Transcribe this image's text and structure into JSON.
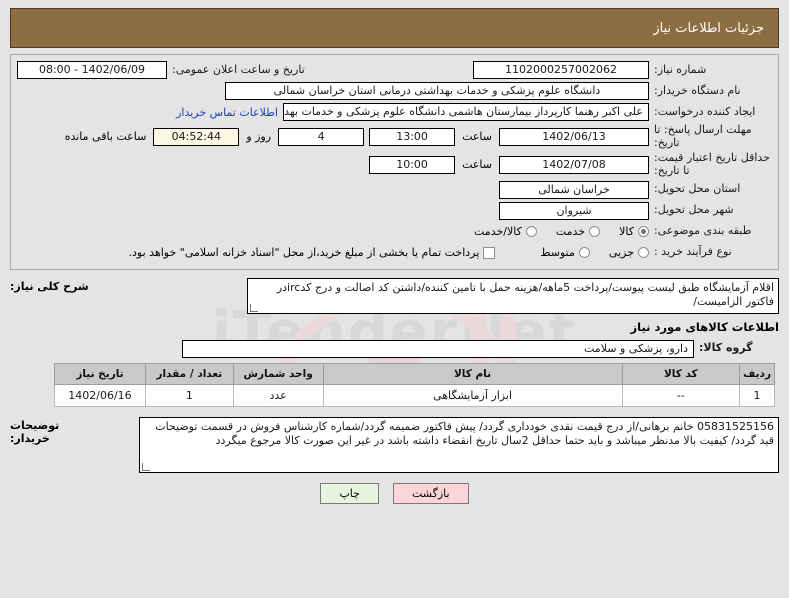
{
  "window": {
    "title": "جزئیات اطلاعات نیاز"
  },
  "colors": {
    "header_bg": "#8d6e42",
    "header_text": "#ffffff",
    "page_bg": "#e4e4e4",
    "field_bg": "#ffffff",
    "link": "#1c3fbf",
    "countdown_bg": "#fbf8e3",
    "table_header_bg": "#c9c9c9",
    "btn_back_bg": "#fbd5d8",
    "btn_print_bg": "#e6f5e0"
  },
  "form": {
    "need_number": {
      "label": "شماره نیاز:",
      "value": "1102000257002062"
    },
    "announce": {
      "label": "تاریخ و ساعت اعلان عمومی:",
      "value": "08:00 - 1402/06/09"
    },
    "buyer_org": {
      "label": "نام دستگاه خریدار:",
      "value": "دانشگاه علوم پزشکی و خدمات بهداشتی درمانی استان خراسان شمالی"
    },
    "creator": {
      "label": "ایجاد کننده درخواست:",
      "value": "علی اکبر رهنما کارپرداز بیمارستان هاشمی دانشگاه علوم پزشکی و خدمات بهد",
      "contact_link": "اطلاعات تماس خریدار"
    },
    "response_deadline": {
      "label": "مهلت ارسال پاسخ: تا تاریخ:",
      "date": "1402/06/13",
      "time_label": "ساعت",
      "time": "13:00",
      "days": "4",
      "days_label": "روز و",
      "clock": "04:52:44",
      "remaining_label": "ساعت باقی مانده"
    },
    "price_validity": {
      "label": "حداقل تاریخ اعتبار قیمت: تا تاریخ:",
      "date": "1402/07/08",
      "time_label": "ساعت",
      "time": "10:00"
    },
    "province": {
      "label": "استان محل تحویل:",
      "value": "خراسان شمالی"
    },
    "city": {
      "label": "شهر محل تحویل:",
      "value": "شیروان"
    },
    "category": {
      "label": "طبقه بندی موضوعی:",
      "options": [
        {
          "text": "کالا",
          "selected": true
        },
        {
          "text": "خدمت",
          "selected": false
        },
        {
          "text": "کالا/خدمت",
          "selected": false
        }
      ]
    },
    "process_type": {
      "label": "نوع فرآیند خرید :",
      "options": [
        {
          "text": "جزیی",
          "selected": false
        },
        {
          "text": "متوسط",
          "selected": false
        }
      ],
      "checkbox": {
        "checked": false,
        "text": "پرداخت تمام یا بخشی از مبلغ خرید،از محل \"اسناد خزانه اسلامی\" خواهد بود."
      }
    },
    "description": {
      "label": "شرح کلی نیاز:",
      "value": "اقلام آزمایشگاه طبق لیست پیوست/پرداخت 5ماهه/هزینه حمل با تامین کننده/داشتن کد اصالت و درج کدircدر فاکتور الزامیست/"
    }
  },
  "goods_section": {
    "heading": "اطلاعات کالاهای مورد نیاز",
    "group": {
      "label": "گروه کالا:",
      "value": "دارو، پزشکی و سلامت"
    },
    "table": {
      "headers": [
        "ردیف",
        "کد کالا",
        "نام کالا",
        "واحد شمارش",
        "تعداد / مقدار",
        "تاریخ نیاز"
      ],
      "rows": [
        {
          "radif": "1",
          "code": "--",
          "name": "ابزار آزمایشگاهی",
          "unit": "عدد",
          "qty": "1",
          "date": "1402/06/16"
        }
      ]
    }
  },
  "buyer_notes": {
    "label": "توضیحات خریدار:",
    "value": "05831525156  خانم برهانی/از درج قیمت نقدی خودداری گردد/ پیش فاکتور ضمیمه گردد/شماره کارشناس فروش در قسمت توضیحات قید گردد/ کیفیت بالا مدنظر میباشد و باید حتما حداقل 2سال تاریخ انقضاء داشته باشد  در غیر این صورت کالا مرجوع میگردد"
  },
  "footer": {
    "back_button": "بازگشت",
    "print_button": "چاپ"
  },
  "watermark": {
    "text": "iTenderNet"
  }
}
